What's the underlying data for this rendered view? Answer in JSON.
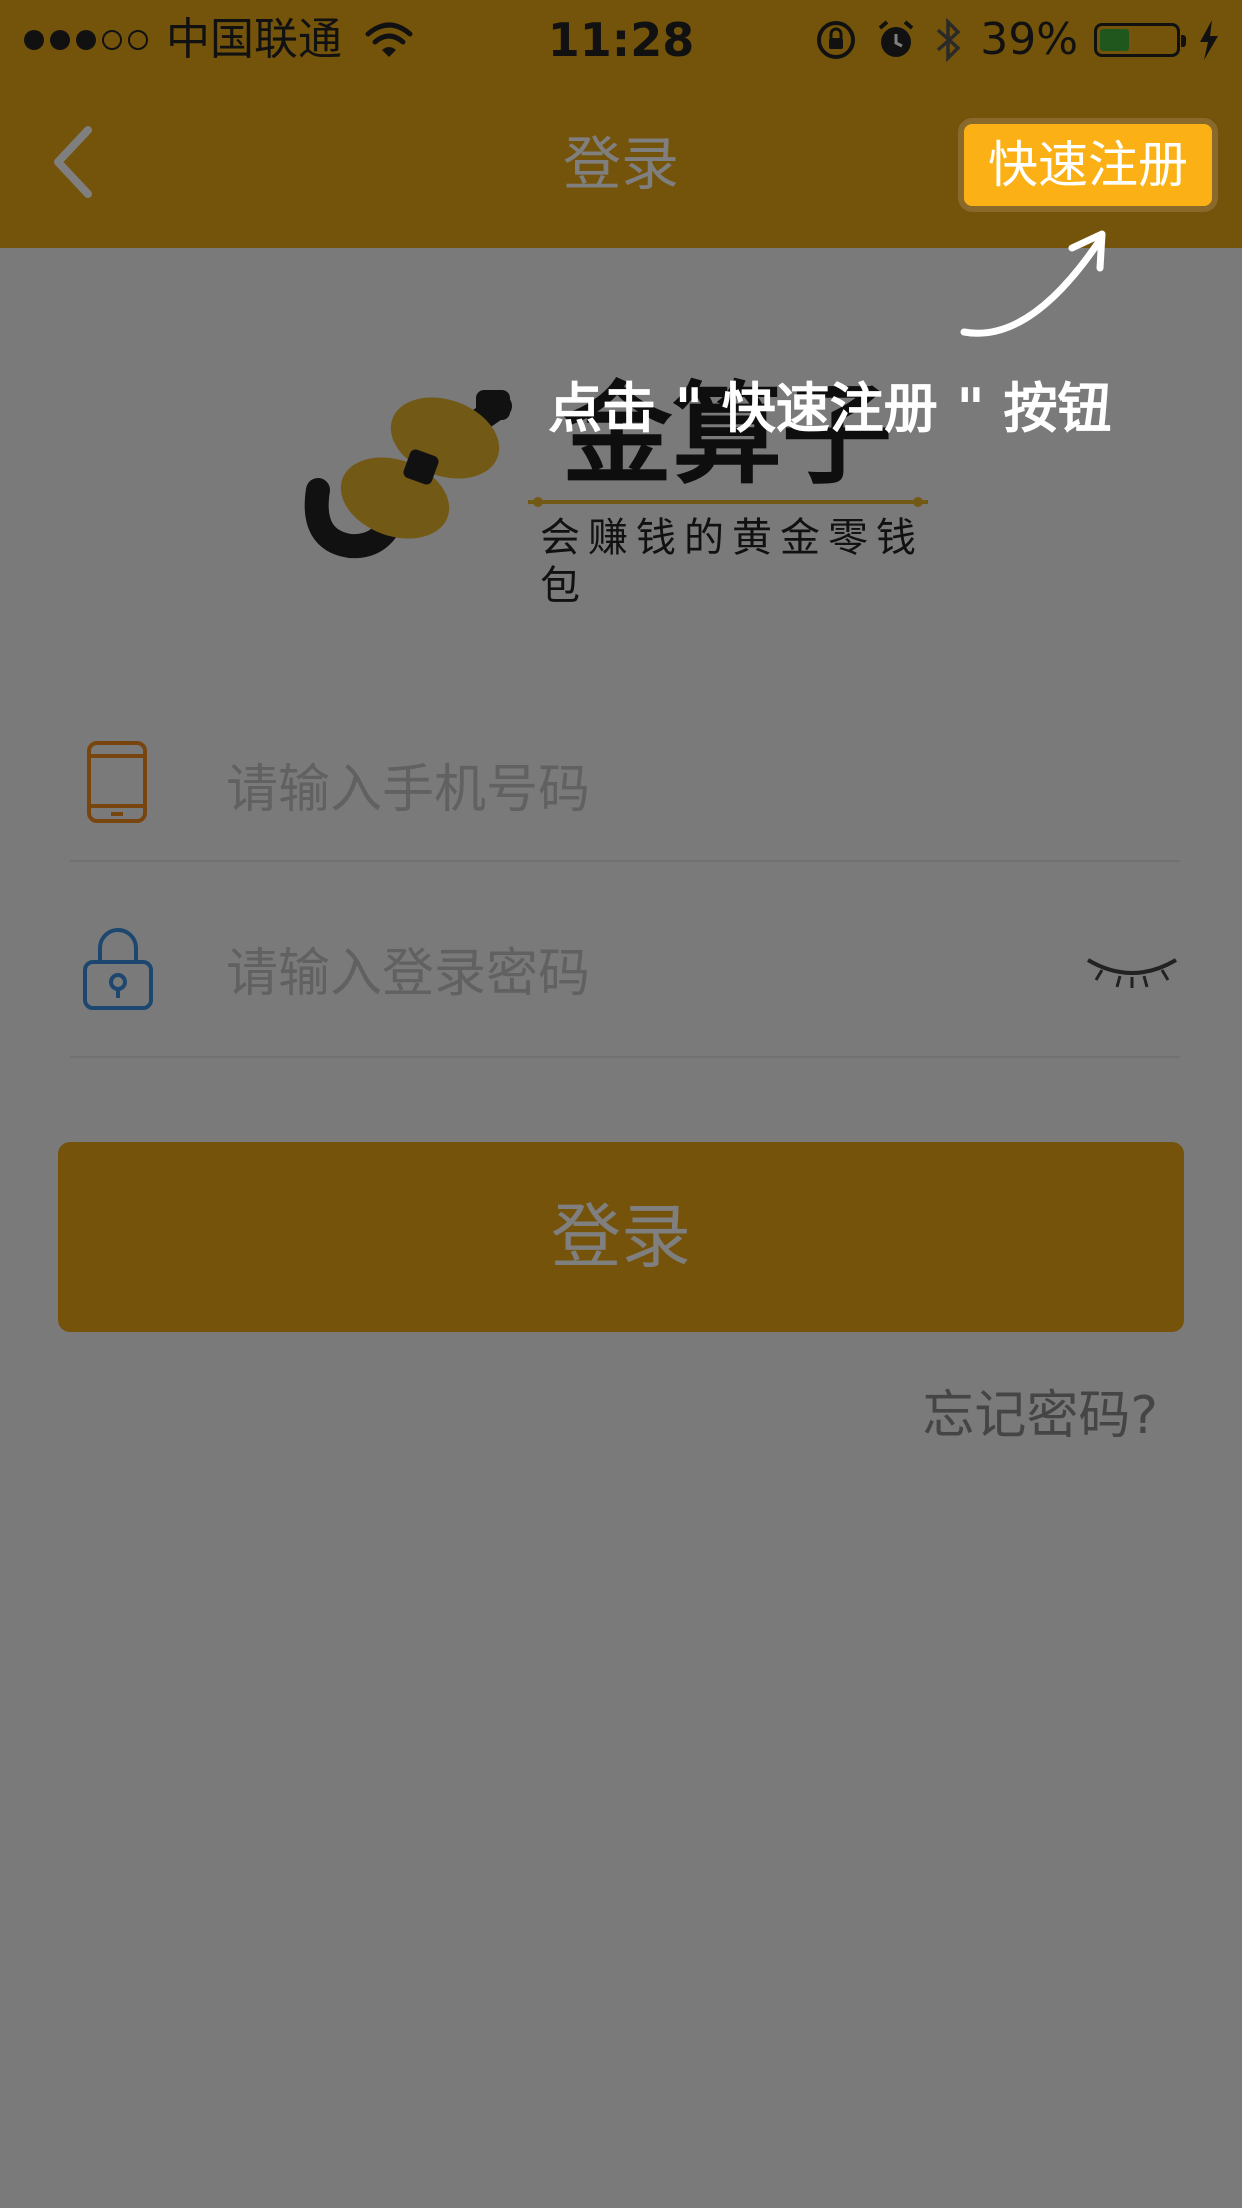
{
  "status_bar": {
    "carrier": "中国联通",
    "time": "11:28",
    "battery_percent": "39%",
    "battery_level": 0.39
  },
  "nav": {
    "title": "登录",
    "register_label": "快速注册"
  },
  "logo": {
    "title": "金算子",
    "subtitle": "会赚钱的黄金零钱包"
  },
  "form": {
    "phone_placeholder": "请输入手机号码",
    "password_placeholder": "请输入登录密码",
    "login_label": "登录",
    "forgot_label": "忘记密码?"
  },
  "overlay": {
    "hint": "点击 \" 快速注册 \" 按钮"
  },
  "colors": {
    "brand": "#E9A814",
    "highlight": "#FBB116",
    "overlay": "rgba(0,0,0,0.5)"
  }
}
